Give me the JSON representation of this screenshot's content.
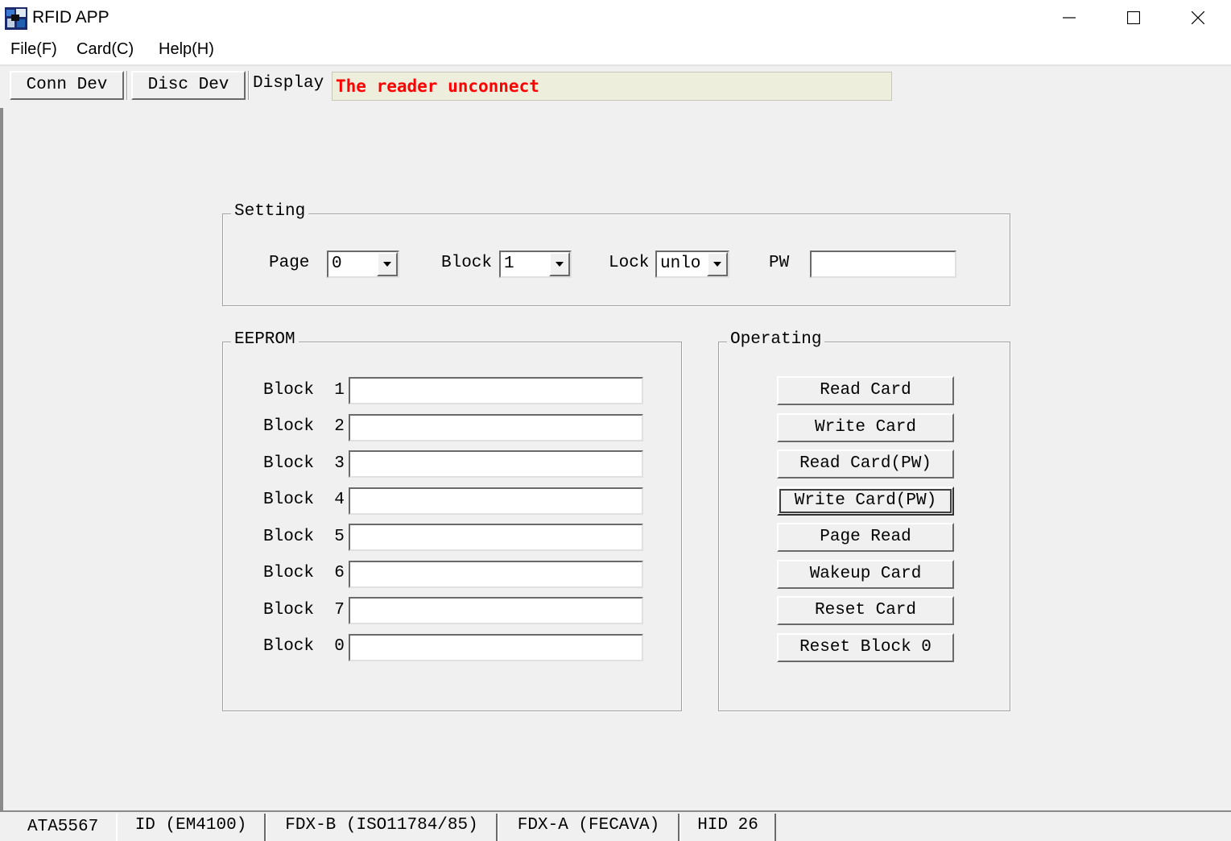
{
  "window": {
    "title": "RFID APP",
    "icon": "rfid-app-icon",
    "controls": [
      "minimize-icon",
      "maximize-icon",
      "close-icon"
    ]
  },
  "menu": {
    "items": [
      "File(F)",
      "Card(C)",
      "Help(H)"
    ]
  },
  "toolbar": {
    "conn_label": "Conn Dev",
    "disc_label": "Disc Dev",
    "display_label": "Display",
    "status_text": "The reader unconnect",
    "status_color": "#ff0000"
  },
  "setting": {
    "legend": "Setting",
    "page_label": "Page",
    "page_value": "0",
    "block_label": "Block",
    "block_value": "1",
    "lock_label": "Lock",
    "lock_value": "unlo",
    "pw_label": "PW",
    "pw_value": ""
  },
  "eeprom": {
    "legend": "EEPROM",
    "rows": [
      {
        "label": "Block  1",
        "value": ""
      },
      {
        "label": "Block  2",
        "value": ""
      },
      {
        "label": "Block  3",
        "value": ""
      },
      {
        "label": "Block  4",
        "value": ""
      },
      {
        "label": "Block  5",
        "value": ""
      },
      {
        "label": "Block  6",
        "value": ""
      },
      {
        "label": "Block  7",
        "value": ""
      },
      {
        "label": "Block  0",
        "value": ""
      }
    ]
  },
  "operating": {
    "legend": "Operating",
    "buttons": [
      "Read Card",
      "Write Card",
      "Read Card(PW)",
      "Write Card(PW)",
      "Page Read",
      "Wakeup Card",
      "Reset Card",
      "Reset Block 0"
    ],
    "focused_button": "Write Card(PW)"
  },
  "tabs": {
    "active": "ATA5567",
    "items": [
      "ID (EM4100)",
      "FDX-B (ISO11784/85)",
      "FDX-A (FECAVA)",
      "HID 26"
    ]
  }
}
